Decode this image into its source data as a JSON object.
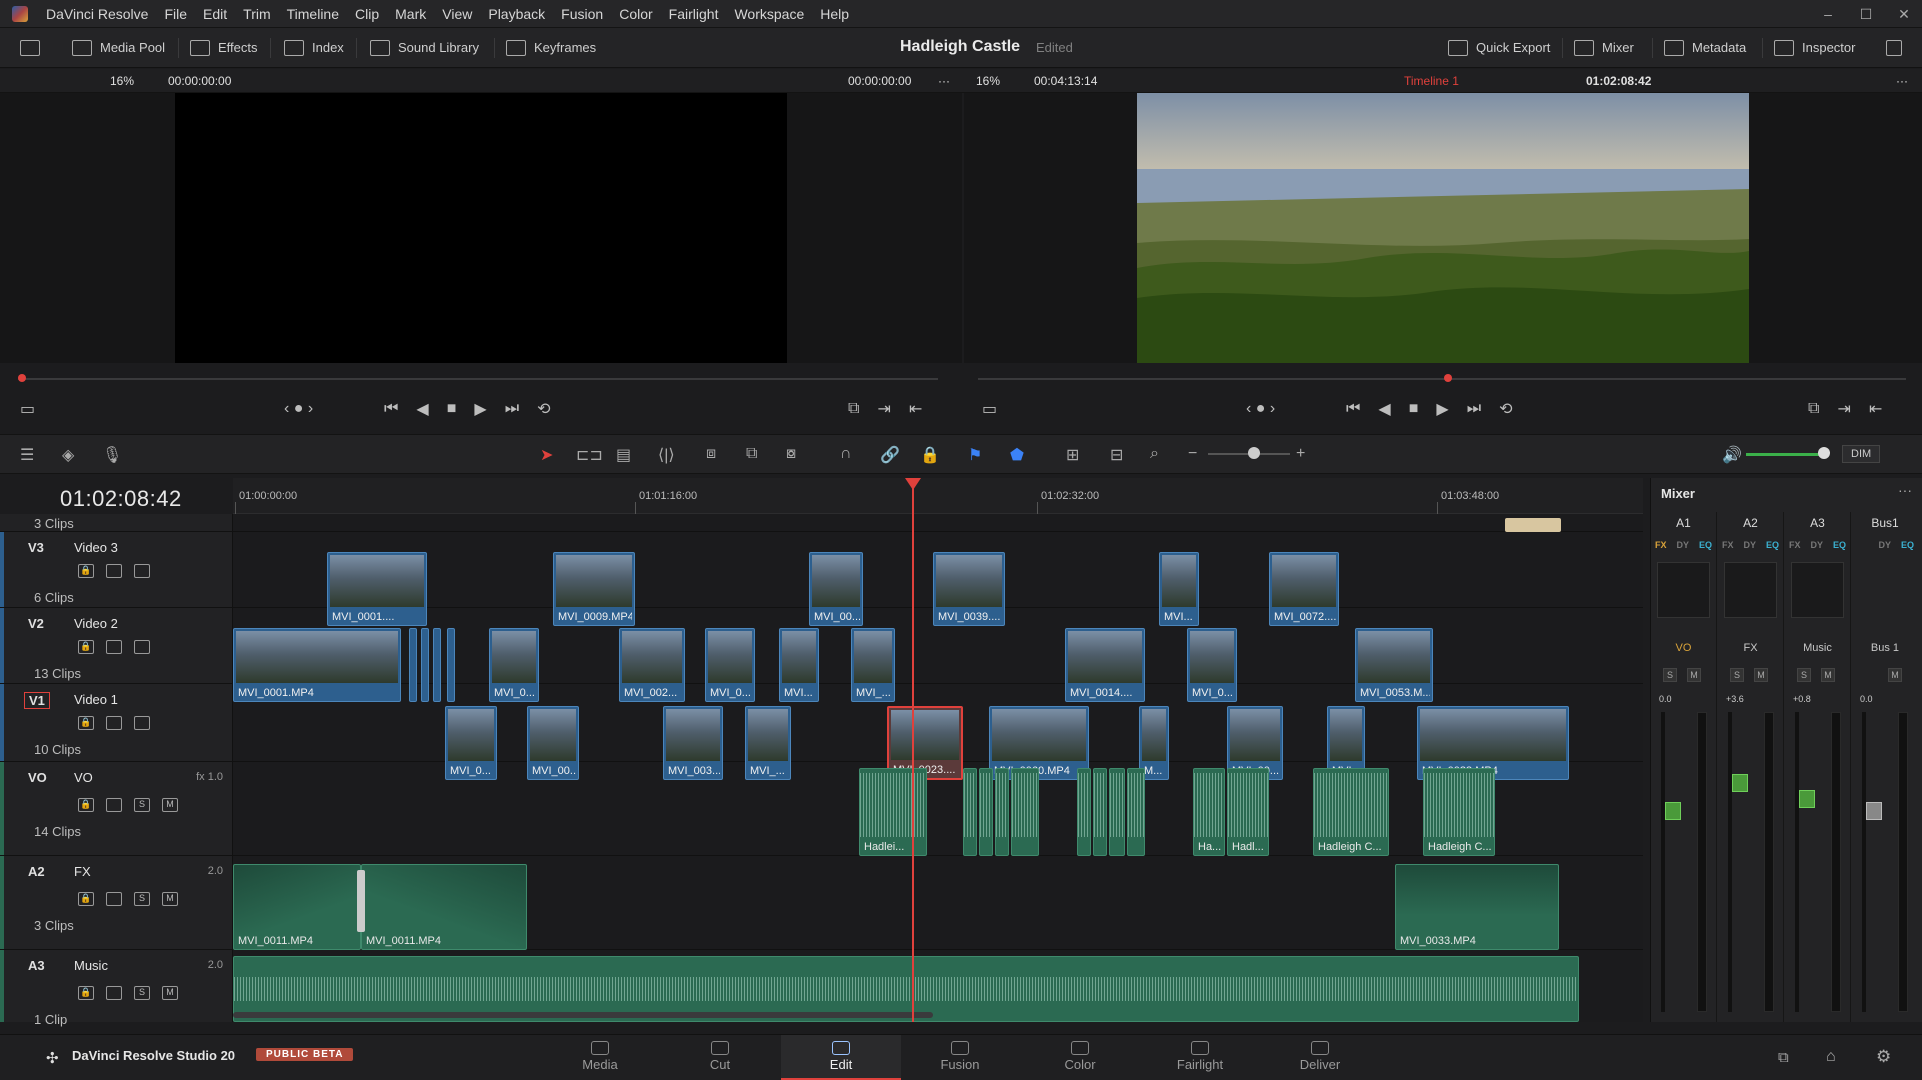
{
  "menubar": {
    "app_name": "DaVinci Resolve",
    "items": [
      "File",
      "Edit",
      "Trim",
      "Timeline",
      "Clip",
      "Mark",
      "View",
      "Playback",
      "Fusion",
      "Color",
      "Fairlight",
      "Workspace",
      "Help"
    ]
  },
  "toolbar": {
    "media_pool": "Media Pool",
    "effects": "Effects",
    "index": "Index",
    "sound_library": "Sound Library",
    "keyframes": "Keyframes",
    "project_title": "Hadleigh Castle",
    "project_status": "Edited",
    "quick_export": "Quick Export",
    "mixer": "Mixer",
    "metadata": "Metadata",
    "inspector": "Inspector"
  },
  "source_viewer": {
    "zoom": "16%",
    "timecode_in": "00:00:00:00",
    "timecode_out": "00:00:00:00"
  },
  "timeline_viewer": {
    "zoom": "16%",
    "duration": "00:04:13:14",
    "timeline_name": "Timeline 1",
    "timecode": "01:02:08:42"
  },
  "timeline": {
    "timecode": "01:02:08:42",
    "ruler": [
      "01:00:00:00",
      "01:01:16:00",
      "01:02:32:00",
      "01:03:48:00"
    ],
    "tracks": [
      {
        "id": "V3",
        "name": "Video 3",
        "count": "6 Clips",
        "top_count": "3 Clips"
      },
      {
        "id": "V2",
        "name": "Video 2",
        "count": "13 Clips"
      },
      {
        "id": "V1",
        "name": "Video 1",
        "count": "10 Clips"
      },
      {
        "id": "VO",
        "name": "VO",
        "count": "14 Clips",
        "vol": "fx 1.0"
      },
      {
        "id": "A2",
        "name": "FX",
        "count": "3 Clips",
        "vol": "2.0"
      },
      {
        "id": "A3",
        "name": "Music",
        "count": "1 Clip",
        "vol": "2.0"
      }
    ],
    "clips": {
      "v3": [
        "MVI_0001....",
        "MVI_0009.MP4",
        "MVI_00...",
        "MVI_0039....",
        "MVI...",
        "MVI_0072...."
      ],
      "v2": [
        "MVI_0001.MP4",
        "MVI_0...",
        "MVI_002...",
        "MVI_0...",
        "MVI...",
        "MVI_...",
        "MVI_0014....",
        "MVI_0...",
        "MVI_0053.M..."
      ],
      "v1": [
        "MVI_0...",
        "MVI_00...",
        "MVI_003...",
        "MVI_...",
        "MVI_0023....",
        "MVI_0060.MP4",
        "M...",
        "MVI_00...",
        "MVI...",
        "MVI_0033.MP4"
      ],
      "vo": [
        "Hadlei...",
        "Ha...",
        "Hadl...",
        "Hadleigh C...",
        "Hadleigh C..."
      ],
      "a2": [
        "MVI_0011.MP4",
        "MVI_0011.MP4",
        "MVI_0033.MP4"
      ]
    }
  },
  "mixer": {
    "title": "Mixer",
    "channels": [
      {
        "hdr": "A1",
        "name": "VO",
        "gain": "0.0",
        "color": "#d9a33a"
      },
      {
        "hdr": "A2",
        "name": "FX",
        "gain": "+3.6",
        "color": "#c8c8c8"
      },
      {
        "hdr": "A3",
        "name": "Music",
        "gain": "+0.8",
        "color": "#c8c8c8"
      },
      {
        "hdr": "Bus1",
        "name": "Bus 1",
        "gain": "0.0",
        "color": "#c8c8c8"
      }
    ],
    "fx_labels": [
      "FX",
      "DY",
      "EQ"
    ],
    "dim": "DIM"
  },
  "pages": [
    "Media",
    "Cut",
    "Edit",
    "Fusion",
    "Color",
    "Fairlight",
    "Deliver"
  ],
  "active_page": "Edit",
  "brand": {
    "name": "DaVinci Resolve Studio 20",
    "badge": "PUBLIC BETA"
  },
  "colors": {
    "accent": "#e0413c",
    "video_clip": "#2d5f8e",
    "audio_clip": "#2b6a52"
  }
}
